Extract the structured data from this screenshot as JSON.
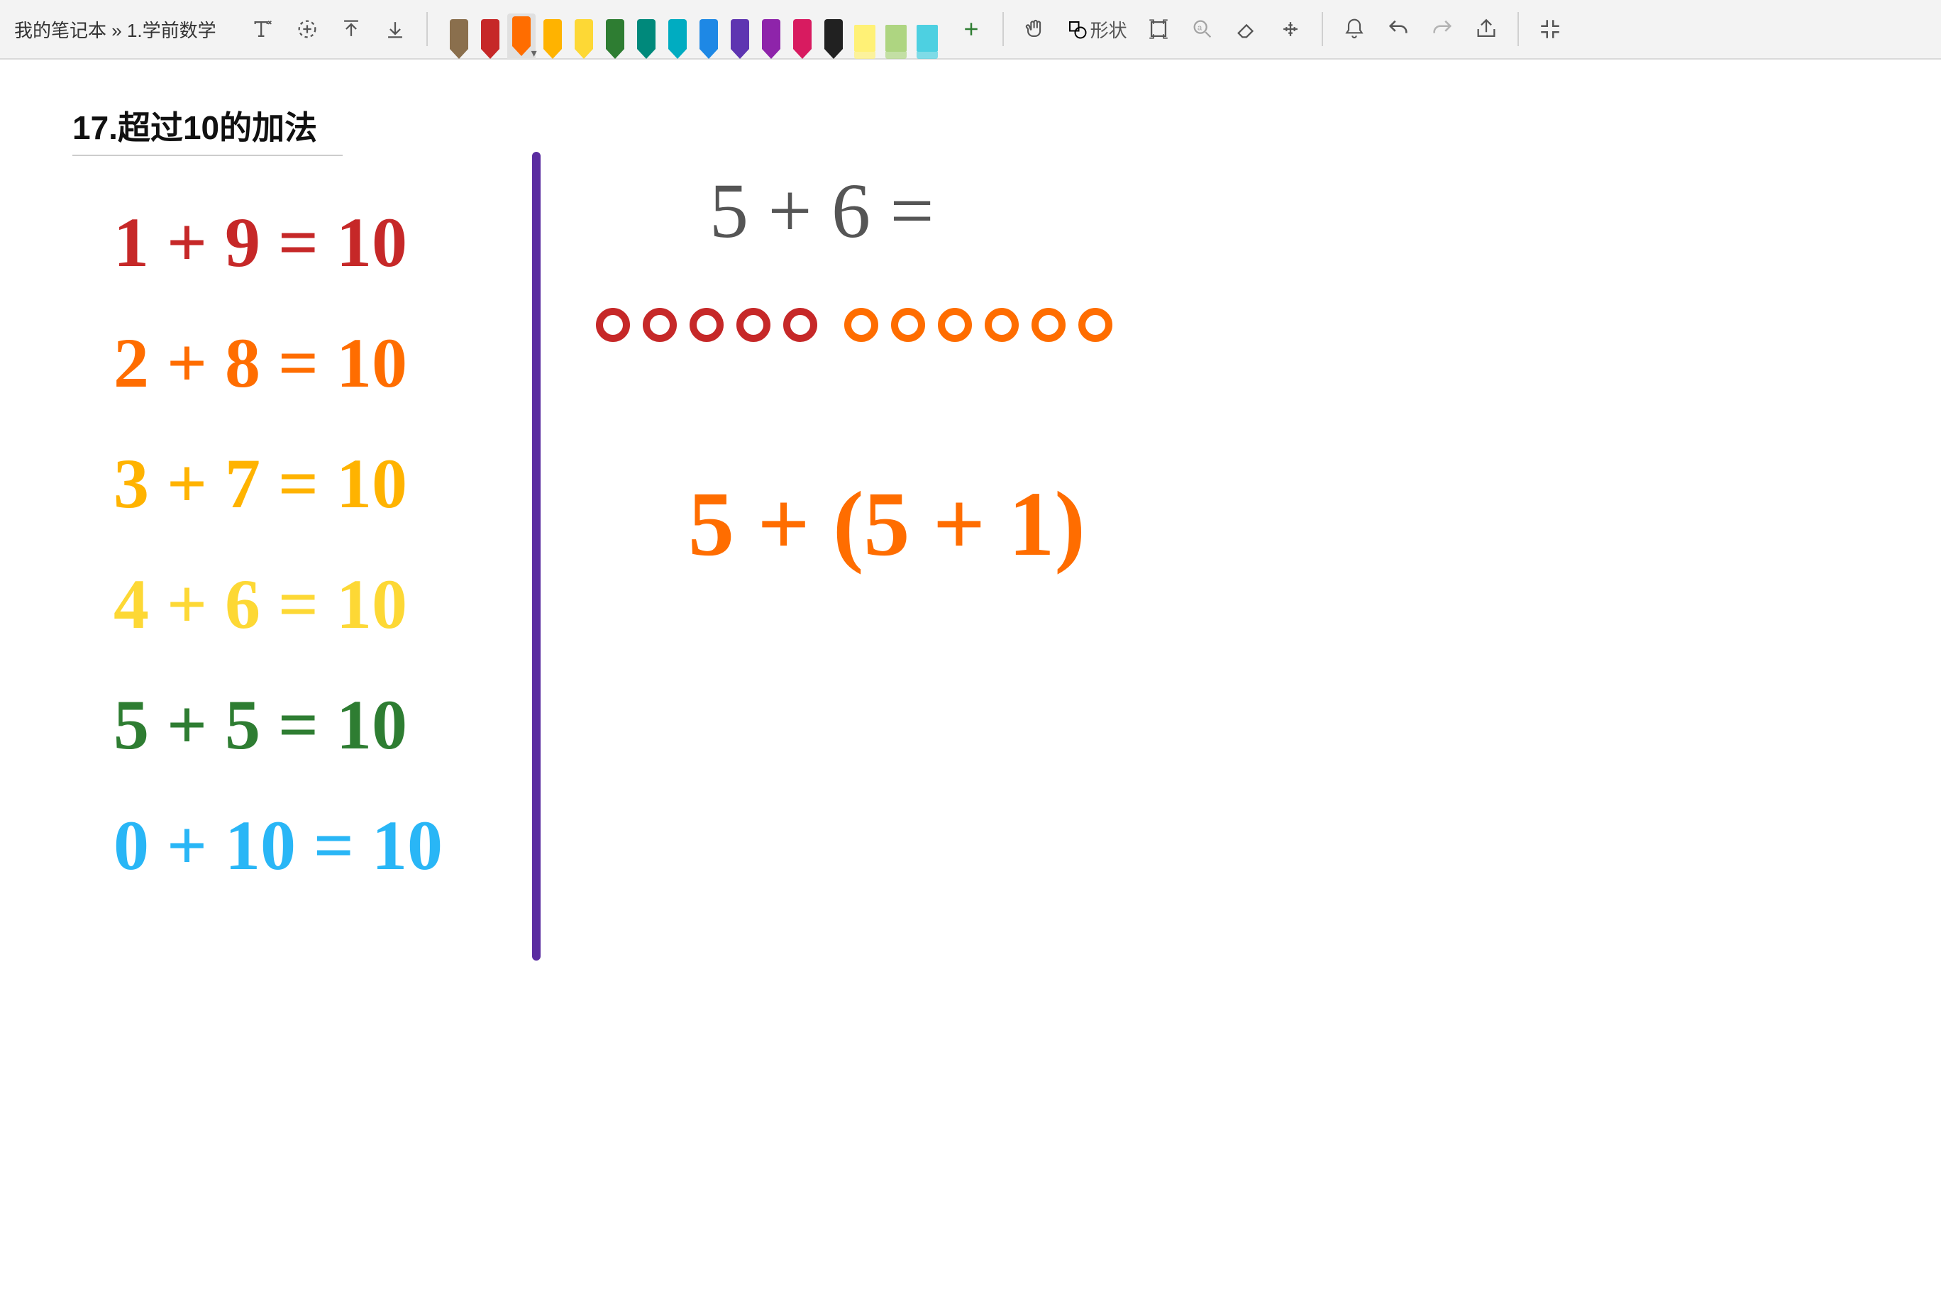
{
  "breadcrumb": {
    "notebook": "我的笔记本",
    "sep": "»",
    "page": "1.学前数学"
  },
  "toolbar": {
    "shape_label": "形状"
  },
  "pens": [
    {
      "color": "#8a6f4d",
      "type": "pen",
      "active": false
    },
    {
      "color": "#c62828",
      "type": "pen",
      "active": false
    },
    {
      "color": "#ff6d00",
      "type": "pen",
      "active": true
    },
    {
      "color": "#ffb300",
      "type": "pen",
      "active": false
    },
    {
      "color": "#fdd835",
      "type": "pen",
      "active": false
    },
    {
      "color": "#2e7d32",
      "type": "pen",
      "active": false
    },
    {
      "color": "#00897b",
      "type": "pen",
      "active": false
    },
    {
      "color": "#00acc1",
      "type": "pen",
      "active": false
    },
    {
      "color": "#1e88e5",
      "type": "pen",
      "active": false
    },
    {
      "color": "#5e35b1",
      "type": "pen",
      "active": false
    },
    {
      "color": "#8e24aa",
      "type": "pen",
      "active": false
    },
    {
      "color": "#d81b60",
      "type": "pen",
      "active": false
    },
    {
      "color": "#212121",
      "type": "pen",
      "active": false
    },
    {
      "color": "#fff176",
      "type": "highlighter",
      "active": false
    },
    {
      "color": "#aed581",
      "type": "highlighter",
      "active": false
    },
    {
      "color": "#4dd0e1",
      "type": "highlighter",
      "active": false
    }
  ],
  "page_title": "17.超过10的加法",
  "equations_left": [
    {
      "text": "1 + 9 = 10",
      "color": "#c62828"
    },
    {
      "text": "2 + 8 = 10",
      "color": "#ff6d00"
    },
    {
      "text": "3 + 7 = 10",
      "color": "#ffb300"
    },
    {
      "text": "4 + 6 = 10",
      "color": "#fdd835"
    },
    {
      "text": "5 + 5 = 10",
      "color": "#2e7d32"
    },
    {
      "text": "0 + 10 = 10",
      "color": "#29b6f6"
    }
  ],
  "right": {
    "problem": "5 + 6 =",
    "circles_a": {
      "count": 5,
      "color": "#c62828"
    },
    "circles_b": {
      "count": 6,
      "color": "#ff6d00"
    },
    "decomposition": "5 + (5 + 1)",
    "decomposition_color": "#ff6d00"
  }
}
